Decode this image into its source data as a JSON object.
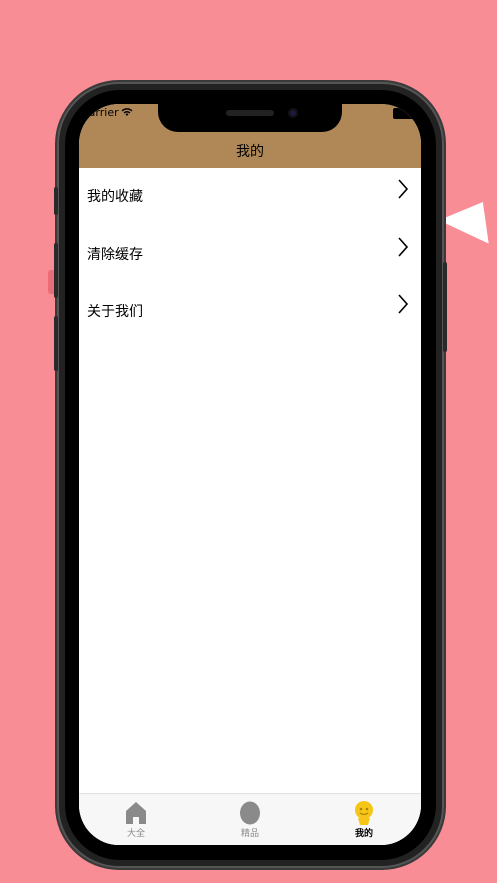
{
  "status_bar": {
    "carrier": "Carrier"
  },
  "nav": {
    "title": "我的"
  },
  "menu": {
    "items": [
      {
        "label": "我的收藏"
      },
      {
        "label": "清除缓存"
      },
      {
        "label": "关于我们"
      }
    ]
  },
  "tabs": [
    {
      "label": "大全",
      "icon": "home-icon",
      "active": false
    },
    {
      "label": "精品",
      "icon": "circle-icon",
      "active": false
    },
    {
      "label": "我的",
      "icon": "profile-icon",
      "active": true
    }
  ],
  "colors": {
    "background": "#f98d95",
    "header": "#b08858",
    "active_tab_icon": "#f5c518",
    "inactive_tab_icon": "#8a8a8a"
  }
}
